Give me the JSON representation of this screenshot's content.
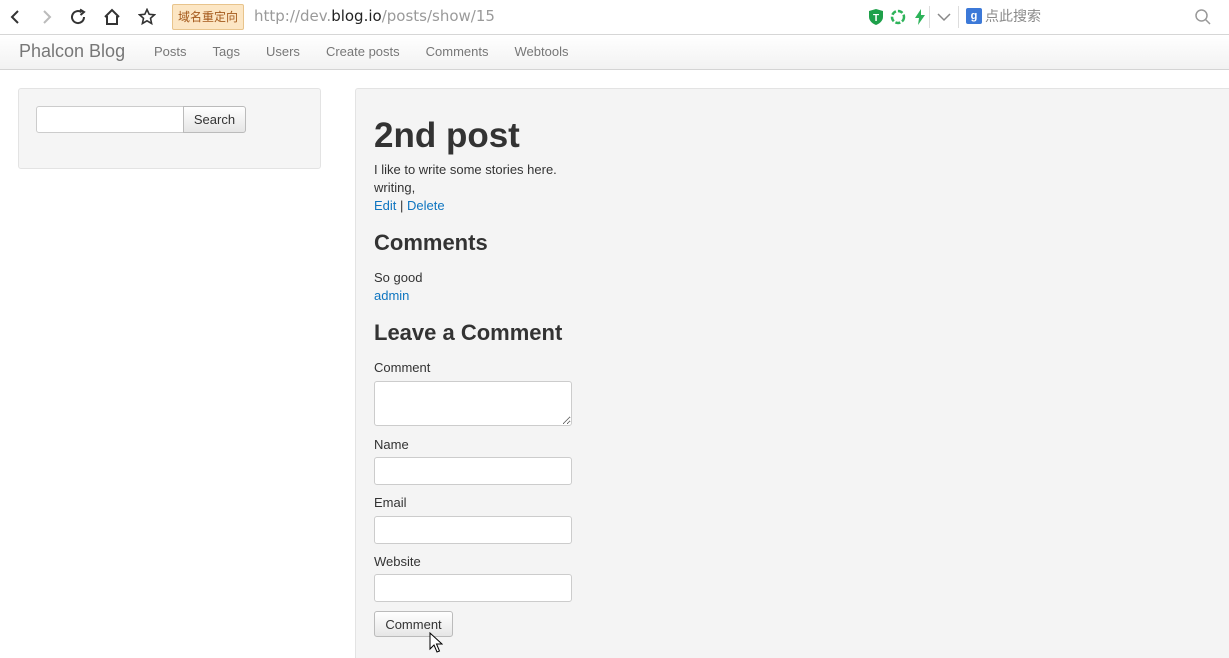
{
  "browser": {
    "redirect_badge": "域名重定向",
    "url_prefix": "http://dev.",
    "url_host": "blog.io",
    "url_path": "/posts/show/15",
    "search_placeholder": "点此搜索",
    "search_engine_letter": "g"
  },
  "navbar": {
    "brand": "Phalcon Blog",
    "links": [
      "Posts",
      "Tags",
      "Users",
      "Create posts",
      "Comments",
      "Webtools"
    ]
  },
  "sidebar": {
    "search_button": "Search",
    "search_value": ""
  },
  "post": {
    "title": "2nd post",
    "body": "I like to write some stories here.",
    "tags": "writing,",
    "edit_label": "Edit",
    "separator": "|",
    "delete_label": "Delete"
  },
  "comments": {
    "heading": "Comments",
    "items": [
      {
        "text": "So good",
        "author": "admin"
      }
    ]
  },
  "form": {
    "heading": "Leave a Comment",
    "comment_label": "Comment",
    "name_label": "Name",
    "email_label": "Email",
    "website_label": "Website",
    "submit_label": "Comment",
    "comment_value": "",
    "name_value": "",
    "email_value": "",
    "website_value": ""
  },
  "colors": {
    "link": "#0e75c0",
    "panel_bg": "#f4f4f4",
    "redirect_badge_bg": "#fce6c4"
  }
}
